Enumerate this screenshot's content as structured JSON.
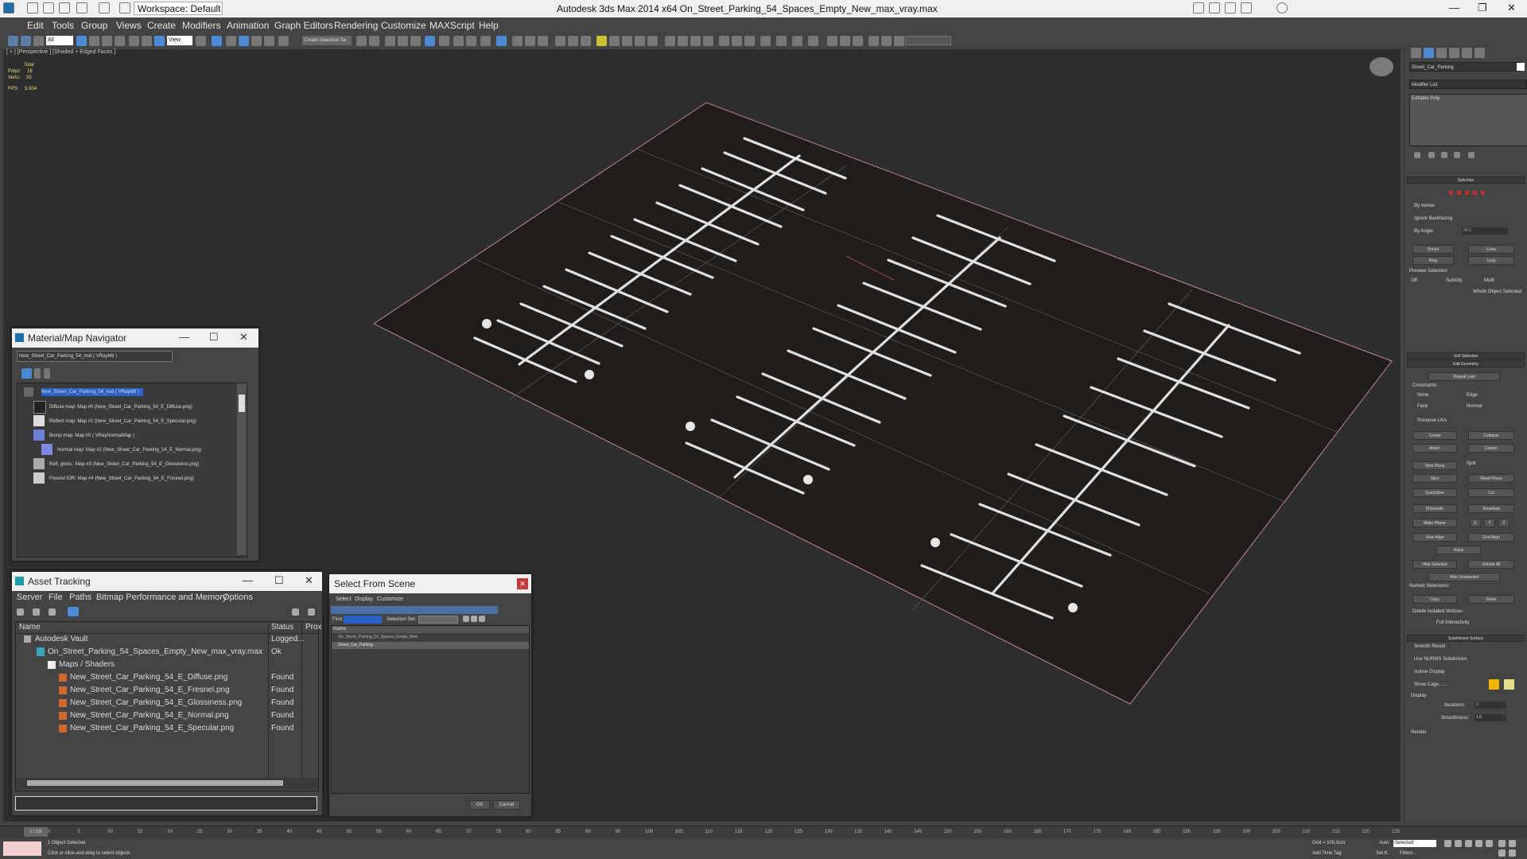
{
  "titlebar": {
    "workspace": "Workspace: Default",
    "app_title": "Autodesk 3ds Max  2014 x64     On_Street_Parking_54_Spaces_Empty_New_max_vray.max"
  },
  "menu": [
    "Edit",
    "Tools",
    "Group",
    "Views",
    "Create",
    "Modifiers",
    "Animation",
    "Graph Editors",
    "Rendering",
    "Customize",
    "MAXScript",
    "Help"
  ],
  "toolbar": {
    "selection_filter": "All",
    "ref_coord": "View",
    "named_set": "Create Selection Se"
  },
  "viewport": {
    "label": "[ + ] [Perspective ] [Shaded + Edged Faces ]",
    "stats": {
      "header": "Total",
      "polys_label": "Polys:",
      "polys": "16",
      "verts_label": "Verts:",
      "verts": "25",
      "fps_label": "FPS:",
      "fps": "5.504"
    }
  },
  "command_panel": {
    "object_name": "Street_Car_Parking",
    "modifier_list": "Modifier List",
    "stack_item": "Editable Poly",
    "selection_hdr": "Selection",
    "by_vertex": "By Vertex",
    "ignore_backfacing": "Ignore Backfacing",
    "by_angle": "By Angle:",
    "by_angle_val": "45.0",
    "shrink": "Shrink",
    "grow": "Grow",
    "ring": "Ring",
    "loop": "Loop",
    "preview_selection": "Preview Selection",
    "off": "Off",
    "subobj": "SubObj",
    "multi": "Multi",
    "whole_object": "Whole Object Selected",
    "soft_selection": "Soft Selection",
    "edit_geometry": "Edit Geometry",
    "repeat_last": "Repeat Last",
    "constraints": "Constraints",
    "none": "None",
    "edge": "Edge",
    "face": "Face",
    "normal": "Normal",
    "preserve_uvs": "Preserve UVs",
    "create": "Create",
    "collapse": "Collapse",
    "attach": "Attach",
    "detach": "Detach",
    "slice_plane": "Slice Plane",
    "split": "Split",
    "slice": "Slice",
    "reset_plane": "Reset Plane",
    "quickslice": "QuickSlice",
    "cut": "Cut",
    "msmooth": "MSmooth",
    "tessellate": "Tessellate",
    "make_planar": "Make Planar",
    "x": "X",
    "y": "Y",
    "z": "Z",
    "view_align": "View Align",
    "grid_align": "Grid Align",
    "relax": "Relax",
    "hide_selected": "Hide Selected",
    "unhide_all": "Unhide All",
    "hide_unselected": "Hide Unselected",
    "named_selections": "Named Selections:",
    "copy": "Copy",
    "paste": "Paste",
    "delete_isolated": "Delete Isolated Vertices",
    "full_interactivity": "Full Interactivity",
    "subdivision_surface": "Subdivision Surface",
    "smooth_result": "Smooth Result",
    "use_nurms": "Use NURMS Subdivision",
    "isoline_display": "Isoline Display",
    "show_cage": "Show Cage......",
    "display": "Display",
    "iterations": "Iterations:",
    "iterations_val": "1",
    "smoothness": "Smoothness:",
    "smoothness_val": "1.0",
    "render": "Render"
  },
  "material_nav": {
    "title": "Material/Map Navigator",
    "field": "New_Street_Car_Parking_54_mat  ( VRayMtl )",
    "items": [
      "New_Street_Car_Parking_54_mat  ( VRayMtl )",
      "Diffuse map: Map #0 (New_Street_Car_Parking_54_E_Diffuse.png)",
      "Reflect map: Map #1 (New_Street_Car_Parking_54_E_Specular.png)",
      "Bump map: Map #5  ( VRayNormalMap )",
      "Normal map: Map #2 (New_Street_Car_Parking_54_E_Normal.png)",
      "Refl. gloss.: Map #3 (New_Street_Car_Parking_54_E_Glossiness.png)",
      "Fresnel IOR: Map #4 (New_Street_Car_Parking_54_E_Fresnel.png)"
    ]
  },
  "asset_tracking": {
    "title": "Asset Tracking",
    "menus": [
      "Server",
      "File",
      "Paths",
      "Bitmap Performance and Memory",
      "Options"
    ],
    "columns": [
      "Name",
      "Status",
      "Prox"
    ],
    "rows": [
      {
        "name": "Autodesk Vault",
        "status": "Logged..."
      },
      {
        "name": "On_Street_Parking_54_Spaces_Empty_New_max_vray.max",
        "status": "Ok"
      },
      {
        "name": "Maps / Shaders",
        "status": ""
      },
      {
        "name": "New_Street_Car_Parking_54_E_Diffuse.png",
        "status": "Found"
      },
      {
        "name": "New_Street_Car_Parking_54_E_Fresnel.png",
        "status": "Found"
      },
      {
        "name": "New_Street_Car_Parking_54_E_Glossiness.png",
        "status": "Found"
      },
      {
        "name": "New_Street_Car_Parking_54_E_Normal.png",
        "status": "Found"
      },
      {
        "name": "New_Street_Car_Parking_54_E_Specular.png",
        "status": "Found"
      }
    ]
  },
  "select_scene": {
    "title": "Select From Scene",
    "menus": [
      "Select",
      "Display",
      "Customize"
    ],
    "find_label": "Find:",
    "selection_set": "Selection Set:",
    "col_name": "Name",
    "items": [
      "On_Street_Parking_54_Spaces_Empty_New",
      "Street_Car_Parking"
    ],
    "ok": "OK",
    "cancel": "Cancel"
  },
  "timeline": {
    "frame": "0 / 225",
    "ticks": [
      "0",
      "5",
      "10",
      "15",
      "20",
      "25",
      "30",
      "35",
      "40",
      "45",
      "50",
      "55",
      "60",
      "65",
      "70",
      "75",
      "80",
      "85",
      "90",
      "95",
      "100",
      "105",
      "110",
      "115",
      "120",
      "125",
      "130",
      "135",
      "140",
      "145",
      "150",
      "155",
      "160",
      "165",
      "170",
      "175",
      "180",
      "185",
      "190",
      "195",
      "200",
      "205",
      "210",
      "215",
      "220",
      "225"
    ]
  },
  "status": {
    "selected": "1 Object Selected",
    "prompt": "Click or click-and-drag to select objects",
    "grid": "Grid = 100,0cm",
    "auto": "Auto",
    "selected_dd": "Selected",
    "set_k": "Set K.",
    "filters": "Filters...",
    "add_time_tag": "Add Time Tag"
  },
  "colors": {
    "viewport_bg": "#2e2e2e",
    "asphalt": "#1e1b19",
    "line_white": "#e8e8e8",
    "selection_box": "#c8849c",
    "highlight": "#2a62c9"
  }
}
